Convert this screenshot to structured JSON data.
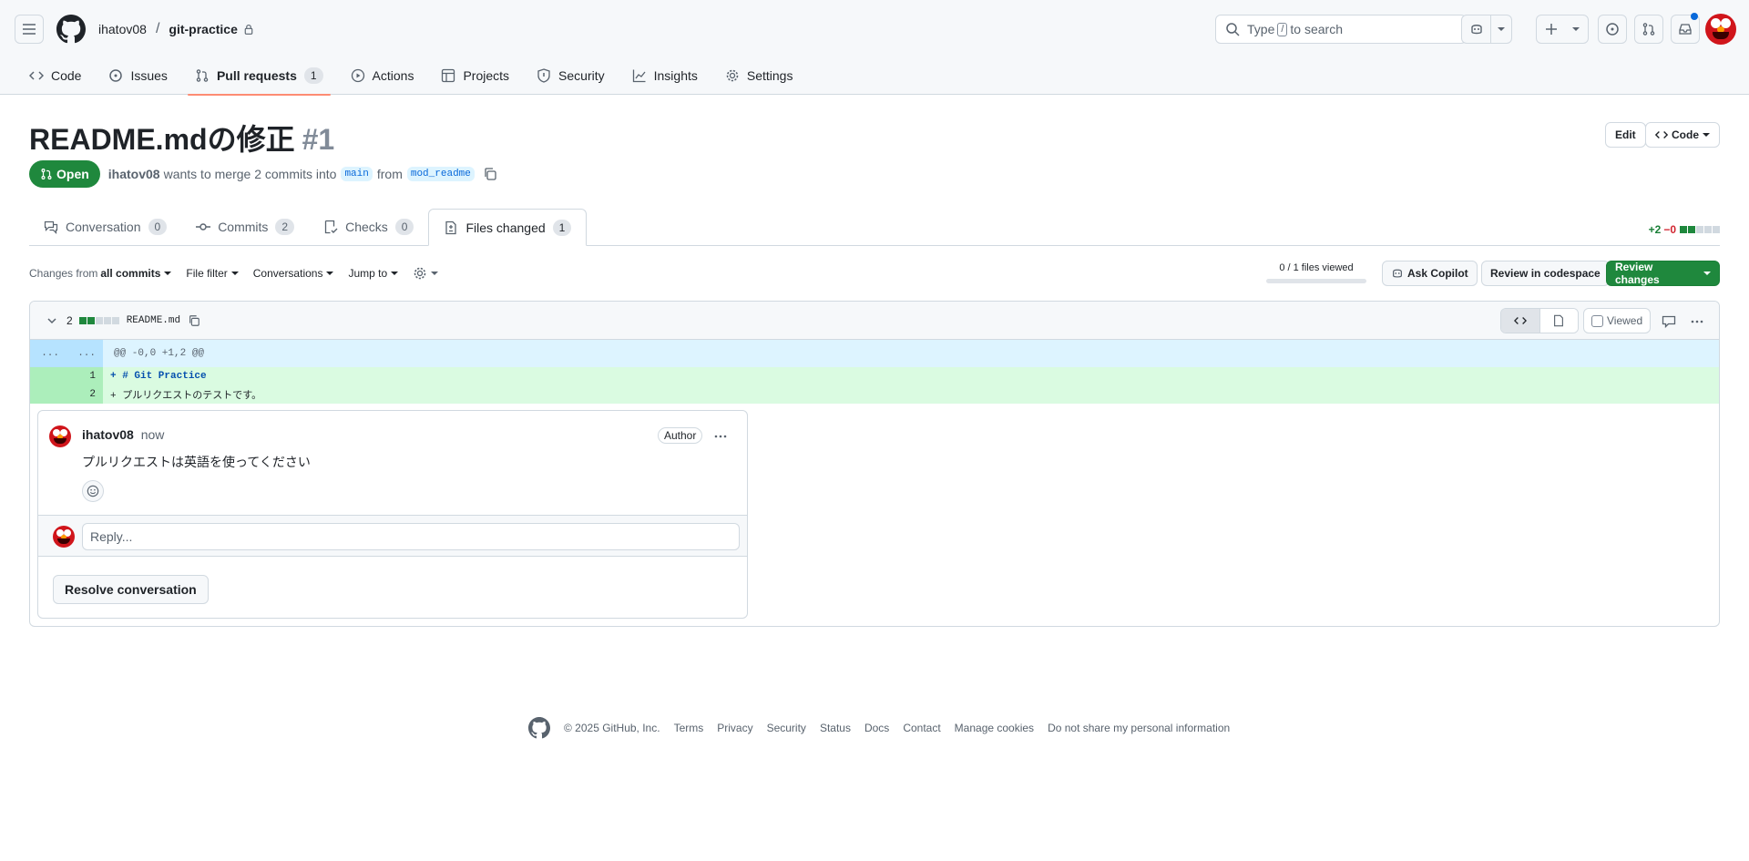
{
  "header": {
    "owner": "ihatov08",
    "repo": "git-practice",
    "search_prefix": "Type",
    "search_key": "/",
    "search_suffix": "to search"
  },
  "nav": [
    {
      "label": "Code",
      "icon": "code-icon"
    },
    {
      "label": "Issues",
      "icon": "issue-icon"
    },
    {
      "label": "Pull requests",
      "icon": "pull-request-icon",
      "count": "1",
      "active": true
    },
    {
      "label": "Actions",
      "icon": "play-icon"
    },
    {
      "label": "Projects",
      "icon": "table-icon"
    },
    {
      "label": "Security",
      "icon": "shield-icon"
    },
    {
      "label": "Insights",
      "icon": "graph-icon"
    },
    {
      "label": "Settings",
      "icon": "gear-icon"
    }
  ],
  "pr": {
    "title": "README.mdの修正",
    "number": "#1",
    "state": "Open",
    "author": "ihatov08",
    "merge_text": "wants to merge 2 commits into",
    "base": "main",
    "from_text": "from",
    "head": "mod_readme",
    "edit_label": "Edit",
    "code_label": "Code"
  },
  "pr_tabs": [
    {
      "label": "Conversation",
      "count": "0"
    },
    {
      "label": "Commits",
      "count": "2"
    },
    {
      "label": "Checks",
      "count": "0"
    },
    {
      "label": "Files changed",
      "count": "1",
      "active": true
    }
  ],
  "diffstat": {
    "added": "+2",
    "removed": "−0"
  },
  "toolbar": {
    "changes_from": "Changes from",
    "all_commits": "all commits",
    "file_filter": "File filter",
    "conversations": "Conversations",
    "jump_to": "Jump to",
    "files_viewed": "0 / 1 files viewed",
    "ask_copilot": "Ask Copilot",
    "review_codespace": "Review in codespace",
    "review_changes": "Review changes"
  },
  "file": {
    "changes": "2",
    "name": "README.md",
    "viewed_label": "Viewed",
    "hunk_left": "...",
    "hunk_right": "...",
    "hunk_header": "@@ -0,0 +1,2 @@",
    "lines": [
      {
        "num": "1",
        "text": "+ # Git Practice",
        "bold": true
      },
      {
        "num": "2",
        "text": "+ プルリクエストのテストです。",
        "bold": false
      }
    ]
  },
  "comment": {
    "author": "ihatov08",
    "time": "now",
    "badge": "Author",
    "body": "プルリクエストは英語を使ってください",
    "reply_placeholder": "Reply...",
    "resolve": "Resolve conversation"
  },
  "footer": {
    "copyright": "© 2025 GitHub, Inc.",
    "links": [
      "Terms",
      "Privacy",
      "Security",
      "Status",
      "Docs",
      "Contact",
      "Manage cookies",
      "Do not share my personal information"
    ]
  },
  "colors": {
    "accent_green": "#1f883d",
    "tab_underline": "#fd8c73",
    "link_blue": "#0969da"
  }
}
